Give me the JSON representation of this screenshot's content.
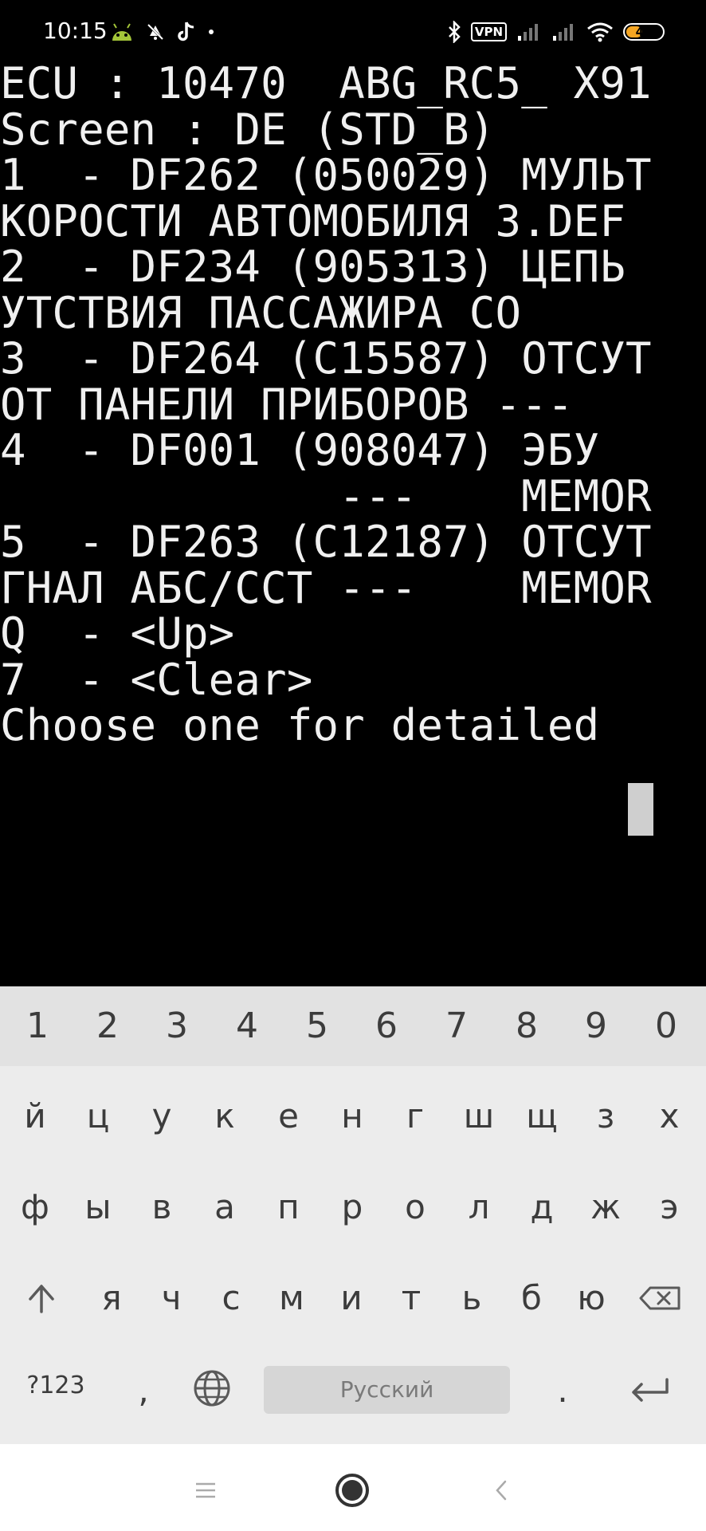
{
  "status_bar": {
    "time": "10:15",
    "vpn_label": "VPN",
    "battery_level": "49",
    "battery_fraction": 0.49,
    "battery_color": "#f5a623",
    "icons": [
      "android-debug-icon",
      "notification-off-icon",
      "tiktok-icon",
      "dot-icon",
      "bluetooth-icon",
      "vpn-icon",
      "signal-icon",
      "signal-icon",
      "wifi-icon",
      "battery-icon"
    ]
  },
  "terminal": {
    "lines": [
      "ECU : 10470  ABG_RC5_ X91",
      "Screen : DE (STD_B)",
      "1  - DF262 (050029) МУЛЬТ",
      "КОРОСТИ АВТОМОБИЛЯ 3.DEF",
      "2  - DF234 (905313) ЦЕПЬ",
      "УТСТВИЯ ПАССАЖИРА СО",
      "3  - DF264 (C15587) ОТСУТ",
      "ОТ ПАНЕЛИ ПРИБОРОВ ---",
      "4  - DF001 (908047) ЭБУ",
      "             ---    MEMOR",
      "5  - DF263 (C12187) ОТСУТ",
      "ГНАЛ АБС/ССТ ---    MEMOR",
      "Q  - <Up>",
      "7  - <Clear>",
      "Choose one for detailed "
    ],
    "text_color": "#f0f0f0",
    "background": "#000000"
  },
  "keyboard": {
    "number_row": [
      "1",
      "2",
      "3",
      "4",
      "5",
      "6",
      "7",
      "8",
      "9",
      "0"
    ],
    "row1": [
      "й",
      "ц",
      "у",
      "к",
      "е",
      "н",
      "г",
      "ш",
      "щ",
      "з",
      "х"
    ],
    "row2": [
      "ф",
      "ы",
      "в",
      "а",
      "п",
      "р",
      "о",
      "л",
      "д",
      "ж",
      "э"
    ],
    "row3": [
      "я",
      "ч",
      "с",
      "м",
      "и",
      "т",
      "ь",
      "б",
      "ю"
    ],
    "symbols_label": "?123",
    "comma_label": ",",
    "space_label": "Русский",
    "period_label": "."
  },
  "nav_bar": {
    "icons": [
      "menu-icon",
      "home-icon",
      "back-icon"
    ]
  }
}
